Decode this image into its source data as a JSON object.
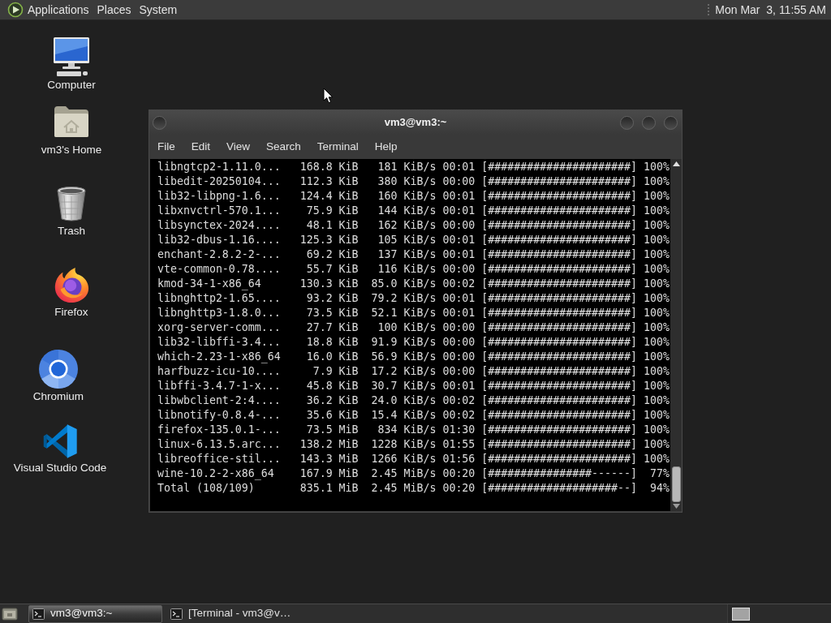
{
  "top_panel": {
    "menus": [
      "Applications",
      "Places",
      "System"
    ],
    "clock": "Mon Mar  3, 11:55 AM"
  },
  "desktop_icons": [
    {
      "kind": "computer",
      "label": "Computer"
    },
    {
      "kind": "home",
      "label": "vm3's Home"
    },
    {
      "kind": "trash",
      "label": "Trash"
    },
    {
      "kind": "firefox",
      "label": "Firefox"
    },
    {
      "kind": "chromium",
      "label": "Chromium"
    },
    {
      "kind": "vscode",
      "label": "Visual Studio Code"
    }
  ],
  "terminal_window": {
    "title": "vm3@vm3:~",
    "menu": [
      "File",
      "Edit",
      "View",
      "Search",
      "Terminal",
      "Help"
    ],
    "lines": [
      "libngtcp2-1.11.0...   168.8 KiB   181 KiB/s 00:01 [######################] 100%",
      "libedit-20250104...   112.3 KiB   380 KiB/s 00:00 [######################] 100%",
      "lib32-libpng-1.6...   124.4 KiB   160 KiB/s 00:01 [######################] 100%",
      "libxnvctrl-570.1...    75.9 KiB   144 KiB/s 00:01 [######################] 100%",
      "libsynctex-2024....    48.1 KiB   162 KiB/s 00:00 [######################] 100%",
      "lib32-dbus-1.16....   125.3 KiB   105 KiB/s 00:01 [######################] 100%",
      "enchant-2.8.2-2-...    69.2 KiB   137 KiB/s 00:01 [######################] 100%",
      "vte-common-0.78....    55.7 KiB   116 KiB/s 00:00 [######################] 100%",
      "kmod-34-1-x86_64      130.3 KiB  85.0 KiB/s 00:02 [######################] 100%",
      "libnghttp2-1.65....    93.2 KiB  79.2 KiB/s 00:01 [######################] 100%",
      "libnghttp3-1.8.0...    73.5 KiB  52.1 KiB/s 00:01 [######################] 100%",
      "xorg-server-comm...    27.7 KiB   100 KiB/s 00:00 [######################] 100%",
      "lib32-libffi-3.4...    18.8 KiB  91.9 KiB/s 00:00 [######################] 100%",
      "which-2.23-1-x86_64    16.0 KiB  56.9 KiB/s 00:00 [######################] 100%",
      "harfbuzz-icu-10....     7.9 KiB  17.2 KiB/s 00:00 [######################] 100%",
      "libffi-3.4.7-1-x...    45.8 KiB  30.7 KiB/s 00:01 [######################] 100%",
      "libwbclient-2:4....    36.2 KiB  24.0 KiB/s 00:02 [######################] 100%",
      "libnotify-0.8.4-...    35.6 KiB  15.4 KiB/s 00:02 [######################] 100%",
      "firefox-135.0.1-...    73.5 MiB   834 KiB/s 01:30 [######################] 100%",
      "linux-6.13.5.arc...   138.2 MiB  1228 KiB/s 01:55 [######################] 100%",
      "libreoffice-stil...   143.3 MiB  1266 KiB/s 01:56 [######################] 100%",
      "wine-10.2-2-x86_64    167.9 MiB  2.45 MiB/s 00:20 [################------]  77%",
      "Total (108/109)       835.1 MiB  2.45 MiB/s 00:20 [####################--]  94%"
    ]
  },
  "taskbar": {
    "tasks": [
      {
        "label": "vm3@vm3:~",
        "selected": true
      },
      {
        "label": "[Terminal - vm3@v…",
        "selected": false
      }
    ]
  }
}
